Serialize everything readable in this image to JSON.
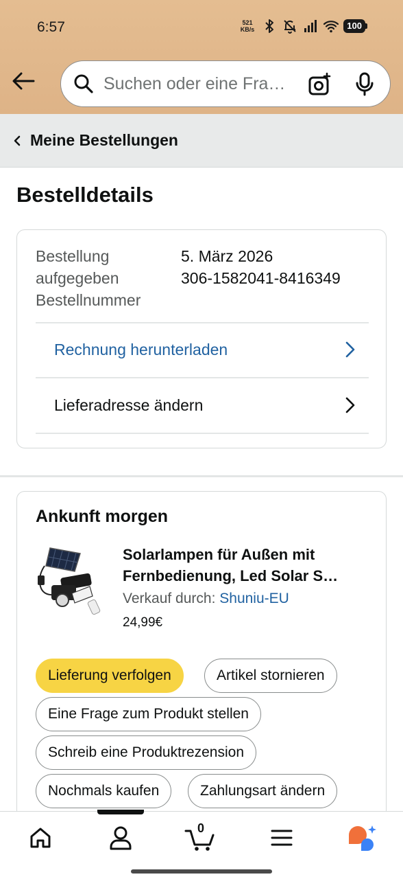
{
  "status_bar": {
    "time": "6:57",
    "net_speed_value": "521",
    "net_speed_unit": "KB/s",
    "battery": "100",
    "icons": [
      "bluetooth-icon",
      "bell-off-icon",
      "signal-icon",
      "wifi-icon"
    ]
  },
  "header": {
    "search_placeholder": "Suchen oder eine Fra…",
    "icons": [
      "back-arrow-icon",
      "search-icon",
      "camera-icon",
      "microphone-icon"
    ]
  },
  "breadcrumb": {
    "label": "Meine Bestellungen"
  },
  "page_title": "Bestelldetails",
  "order": {
    "labels": [
      "Bestellung",
      "aufgegeben",
      "Bestellnummer"
    ],
    "date": "5. März 2026",
    "number": "306-1582041-8416349",
    "invoice_link": "Rechnung herunterladen",
    "address_link": "Lieferadresse ändern"
  },
  "shipment": {
    "arrival": "Ankunft morgen",
    "product_title": "Solarlampen für Außen mit Fernbedienung, Led Solar S…",
    "seller_label": "Verkauf durch:",
    "seller_name": "Shuniu-EU",
    "price": "24,99€",
    "actions": {
      "track": "Lieferung verfolgen",
      "cancel": "Artikel stornieren",
      "question": "Eine Frage zum Produkt stellen",
      "review": "Schreib eine Produktrezension",
      "buy_again": "Nochmals kaufen",
      "payment": "Zahlungsart ändern"
    }
  },
  "bottom_nav": {
    "cart_count": "0",
    "items": [
      "home-icon",
      "account-icon",
      "cart-icon",
      "menu-icon",
      "rufus-icon"
    ],
    "active": "account-icon"
  },
  "colors": {
    "header_bg": "#e2b98c",
    "link_blue": "#2162a1",
    "primary_button": "#f7d444",
    "rufus_orange": "#f0703a",
    "rufus_blue": "#3b82f6"
  }
}
